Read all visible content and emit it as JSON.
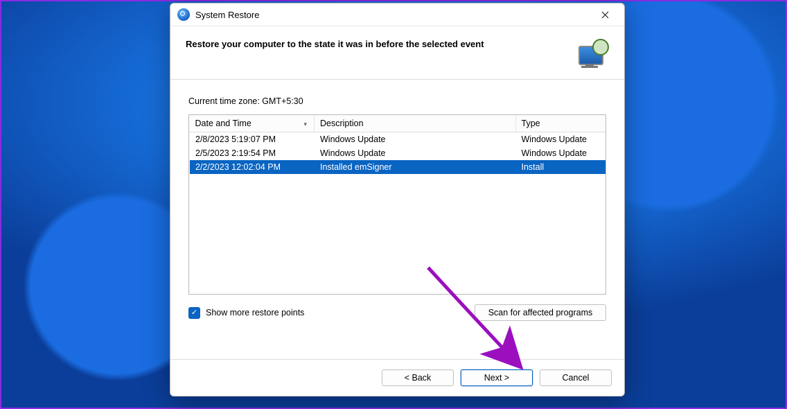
{
  "window": {
    "title": "System Restore"
  },
  "header": {
    "heading": "Restore your computer to the state it was in before the selected event"
  },
  "body": {
    "timezone_label": "Current time zone: GMT+5:30",
    "columns": {
      "date": "Date and Time",
      "description": "Description",
      "type": "Type"
    },
    "rows": [
      {
        "date": "2/8/2023 5:19:07 PM",
        "description": "Windows Update",
        "type": "Windows Update",
        "selected": false
      },
      {
        "date": "2/5/2023 2:19:54 PM",
        "description": "Windows Update",
        "type": "Windows Update",
        "selected": false
      },
      {
        "date": "2/2/2023 12:02:04 PM",
        "description": "Installed emSigner",
        "type": "Install",
        "selected": true
      }
    ],
    "show_more_label": "Show more restore points",
    "show_more_checked": true,
    "scan_affected_label": "Scan for affected programs"
  },
  "footer": {
    "back": "< Back",
    "next": "Next >",
    "cancel": "Cancel"
  }
}
